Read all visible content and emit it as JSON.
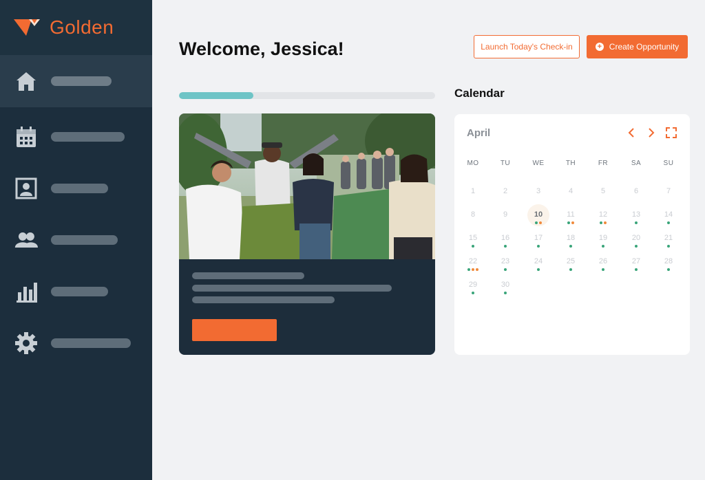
{
  "brand": {
    "name": "Golden"
  },
  "sidebar": {
    "items": [
      {
        "icon": "home-icon",
        "active": true
      },
      {
        "icon": "calendar-icon",
        "active": false
      },
      {
        "icon": "profile-icon",
        "active": false
      },
      {
        "icon": "people-icon",
        "active": false
      },
      {
        "icon": "bar-chart-icon",
        "active": false
      },
      {
        "icon": "gear-icon",
        "active": false
      }
    ]
  },
  "header": {
    "welcome": "Welcome, Jessica!",
    "checkin_label": "Launch Today's Check-in",
    "create_label": "Create Opportunity"
  },
  "progress": {
    "fraction": 0.29
  },
  "calendar": {
    "title": "Calendar",
    "month": "April",
    "weekdays": [
      "MO",
      "TU",
      "WE",
      "TH",
      "FR",
      "SA",
      "SU"
    ],
    "today": 10,
    "days": [
      {
        "d": 1,
        "dots": []
      },
      {
        "d": 2,
        "dots": []
      },
      {
        "d": 3,
        "dots": []
      },
      {
        "d": 4,
        "dots": []
      },
      {
        "d": 5,
        "dots": []
      },
      {
        "d": 6,
        "dots": []
      },
      {
        "d": 7,
        "dots": []
      },
      {
        "d": 8,
        "dots": []
      },
      {
        "d": 9,
        "dots": []
      },
      {
        "d": 10,
        "dots": [
          "green",
          "orange"
        ]
      },
      {
        "d": 11,
        "dots": [
          "green",
          "orange"
        ]
      },
      {
        "d": 12,
        "dots": [
          "green",
          "orange"
        ]
      },
      {
        "d": 13,
        "dots": [
          "green"
        ]
      },
      {
        "d": 14,
        "dots": [
          "green"
        ]
      },
      {
        "d": 15,
        "dots": [
          "green"
        ]
      },
      {
        "d": 16,
        "dots": [
          "green"
        ]
      },
      {
        "d": 17,
        "dots": [
          "green"
        ]
      },
      {
        "d": 18,
        "dots": [
          "green"
        ]
      },
      {
        "d": 19,
        "dots": [
          "green"
        ]
      },
      {
        "d": 20,
        "dots": [
          "green"
        ]
      },
      {
        "d": 21,
        "dots": [
          "green"
        ]
      },
      {
        "d": 22,
        "dots": [
          "green",
          "orange",
          "orange"
        ]
      },
      {
        "d": 23,
        "dots": [
          "green"
        ]
      },
      {
        "d": 24,
        "dots": [
          "green"
        ]
      },
      {
        "d": 25,
        "dots": [
          "green"
        ]
      },
      {
        "d": 26,
        "dots": [
          "green"
        ]
      },
      {
        "d": 27,
        "dots": [
          "green"
        ]
      },
      {
        "d": 28,
        "dots": [
          "green"
        ]
      },
      {
        "d": 29,
        "dots": [
          "green"
        ]
      },
      {
        "d": 30,
        "dots": [
          "green"
        ]
      }
    ]
  },
  "colors": {
    "accent": "#f26b32",
    "sidebar": "#1c2e3d",
    "progress": "#6ec4c6",
    "dot_green": "#3aa57a",
    "dot_orange": "#f08a3c"
  }
}
